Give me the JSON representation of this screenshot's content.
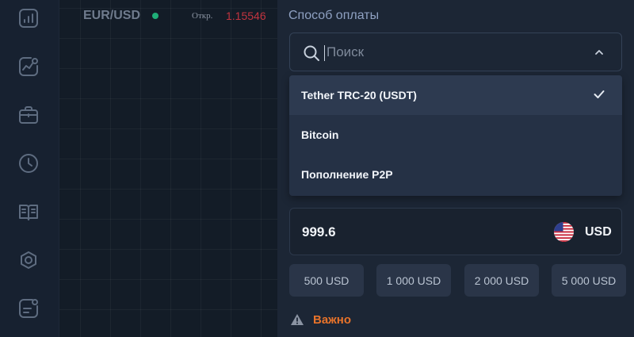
{
  "chart": {
    "pair": "EUR/USD",
    "open_label": "Откр.",
    "open_value": "1.15546"
  },
  "sidebar": {
    "icons": [
      "chart-icon",
      "analytics-icon",
      "briefcase-icon",
      "clock-icon",
      "book-icon",
      "gear-icon",
      "notes-icon"
    ]
  },
  "payment": {
    "title": "Способ оплаты",
    "search_placeholder": "Поиск",
    "options": [
      {
        "label": "Tether TRC-20 (USDT)",
        "selected": true
      },
      {
        "label": "Bitcoin",
        "selected": false
      },
      {
        "label": "Пополнение P2P",
        "selected": false
      }
    ]
  },
  "amount": {
    "value": "999.6",
    "currency": "USD"
  },
  "presets": [
    "500 USD",
    "1 000 USD",
    "2 000 USD",
    "5 000 USD"
  ],
  "notice": {
    "label": "Важно"
  },
  "colors": {
    "accent_warning": "#e8732a",
    "open_value": "#c2343f",
    "status_dot": "#1fae78"
  }
}
